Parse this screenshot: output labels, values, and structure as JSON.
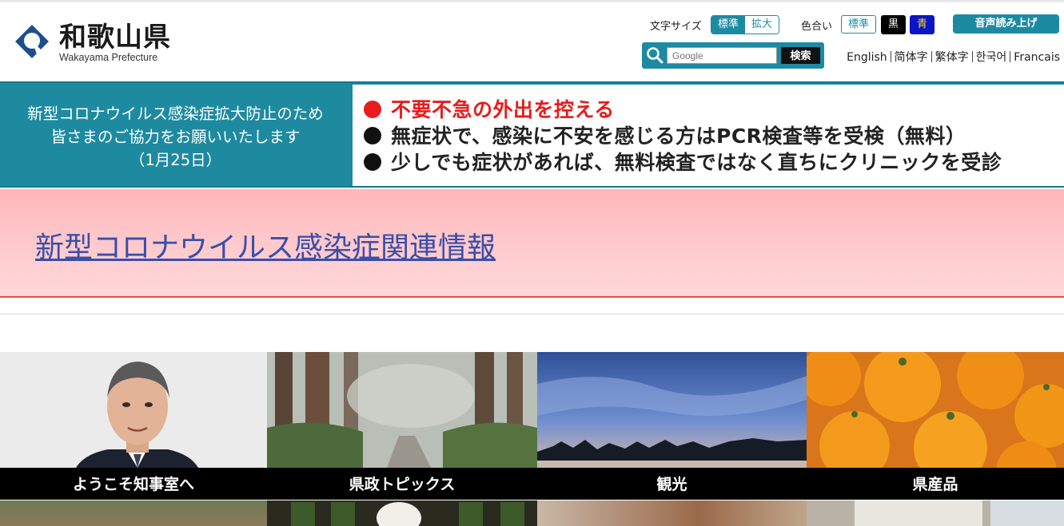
{
  "header": {
    "logo_name": "和歌山県",
    "logo_sub": "Wakayama Prefecture",
    "font_size_label": "文字サイズ",
    "font_size_standard": "標準",
    "font_size_large": "拡大",
    "color_label": "色合い",
    "color_standard": "標準",
    "color_black": "黒",
    "color_blue": "青",
    "voice_button": "音声読み上げ",
    "search_placeholder": "Google",
    "search_button": "検索",
    "languages": [
      "English",
      "简体字",
      "繁体字",
      "한국어",
      "Francais"
    ]
  },
  "banner": {
    "left_line1": "新型コロナウイルス感染症拡大防止のため",
    "left_line2": "皆さまのご協力をお願いいたします",
    "left_line3": "（1月25日）",
    "item1": "不要不急の外出を控える",
    "item2": "無症状で、感染に不安を感じる方はPCR検査等を受検（無料）",
    "item3": "少しでも症状があれば、無料検査ではなく直ちにクリニックを受診"
  },
  "covid_link": "新型コロナウイルス感染症関連情報",
  "tiles": [
    {
      "label": "ようこそ知事室へ"
    },
    {
      "label": "県政トピックス"
    },
    {
      "label": "観光"
    },
    {
      "label": "県産品"
    }
  ],
  "colors": {
    "brand_teal": "#1d8aa3",
    "alert_red": "#e81c1c",
    "pink_bg": "#ffc7ca",
    "link_blue": "#3a4ea8"
  },
  "icons": [
    "wakayama-logo-icon",
    "search-icon"
  ]
}
